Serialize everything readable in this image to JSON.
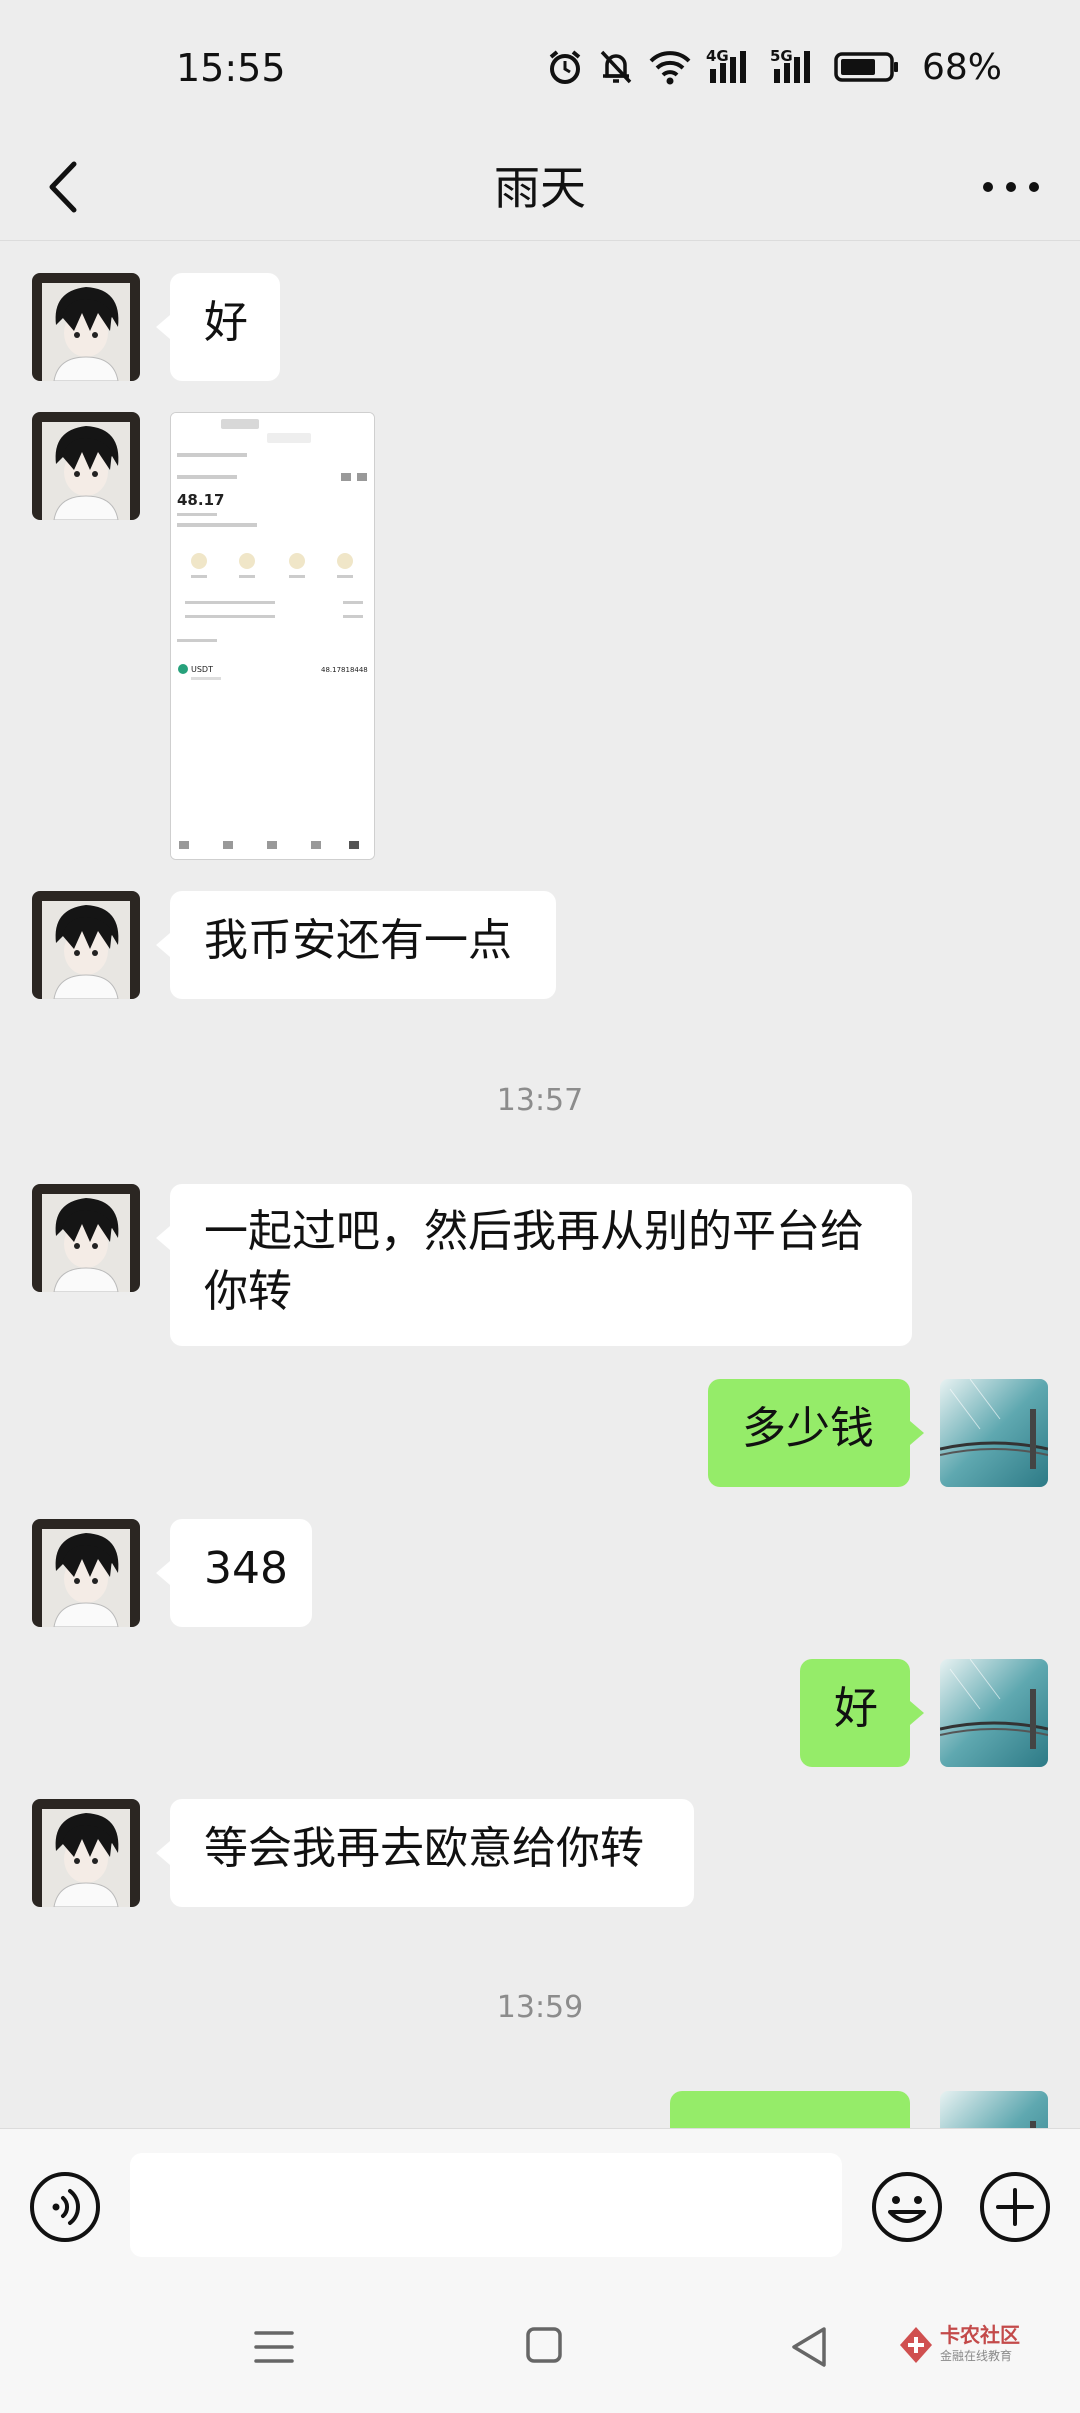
{
  "status_bar": {
    "time": "15:55",
    "battery": "68%",
    "network_1": "4G",
    "network_2": "5G"
  },
  "header": {
    "title": "雨天"
  },
  "messages": [
    {
      "side": "in",
      "text": "好"
    },
    {
      "side": "in",
      "type": "image",
      "preview": {
        "balance": "48.17",
        "coin": "USDT",
        "amount": "48.17818448"
      }
    },
    {
      "side": "in",
      "text": "我币安还有一点"
    },
    {
      "type": "timestamp",
      "text": "13:57"
    },
    {
      "side": "in",
      "text_line1": "一起过吧，然后我再从别的平台给",
      "text_line2": "你转"
    },
    {
      "side": "out",
      "text": "多少钱"
    },
    {
      "side": "in",
      "text": "348"
    },
    {
      "side": "out",
      "text": "好"
    },
    {
      "side": "in",
      "text": "等会我再去欧意给你转"
    },
    {
      "type": "timestamp",
      "text": "13:59"
    },
    {
      "side": "out",
      "text": ""
    }
  ],
  "input": {
    "value": ""
  },
  "watermark": {
    "line1": "卡农社区",
    "line2": "金融在线教育"
  },
  "colors": {
    "outgoing_bubble": "#95ec69",
    "incoming_bubble": "#ffffff",
    "background": "#ededed"
  }
}
